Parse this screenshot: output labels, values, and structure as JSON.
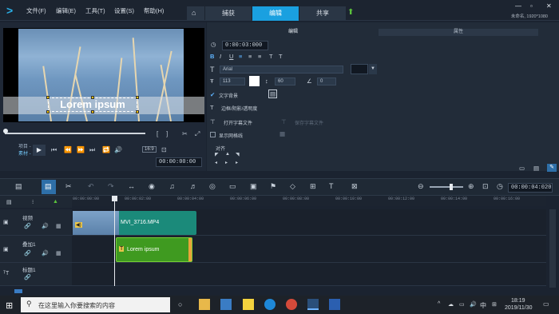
{
  "menu": [
    "文件(F)",
    "编辑(E)",
    "工具(T)",
    "设置(S)",
    "帮助(H)"
  ],
  "tabs": [
    "捕获",
    "编辑",
    "共享"
  ],
  "resolution": "未命名, 1920*1080",
  "preview": {
    "overlay_title": "Lorem ipsum",
    "project_label": "项目 -",
    "clip_label": "素材 -",
    "aspect": "16:9",
    "timecode": "00:00:00:00"
  },
  "options": {
    "subtabs": [
      "编辑",
      "属性"
    ],
    "duration": "0:00:03:000",
    "font": "Arial",
    "font_size": "113",
    "line_spacing": "60",
    "angle": "0",
    "text_background": "文字背景",
    "border_shadow": "边框/阴影/透明度",
    "open_subtitle": "打开字幕文件",
    "save_subtitle": "保存字幕文件",
    "show_grid": "显示网格线",
    "align": "对齐"
  },
  "timeline": {
    "timecode": "00:00:04:020",
    "ruler_ticks": [
      "00:00:00:00",
      "00:00:02:00",
      "00:00:04:00",
      "00:00:06:00",
      "00:00:08:00",
      "00:00:10:00",
      "00:00:12:00",
      "00:00:14:00",
      "00:00:16:00"
    ],
    "tracks": [
      {
        "label": "视频"
      },
      {
        "label": "叠加1"
      },
      {
        "label": "标题1"
      }
    ],
    "video_clip": "MVI_3716.MP4",
    "title_clip": "Lorem ipsum",
    "title_clip_marker": "T"
  },
  "taskbar": {
    "search_placeholder": "在这里输入你要搜索的内容",
    "ime": "中",
    "time": "18:19",
    "date": "2019/11/30"
  }
}
